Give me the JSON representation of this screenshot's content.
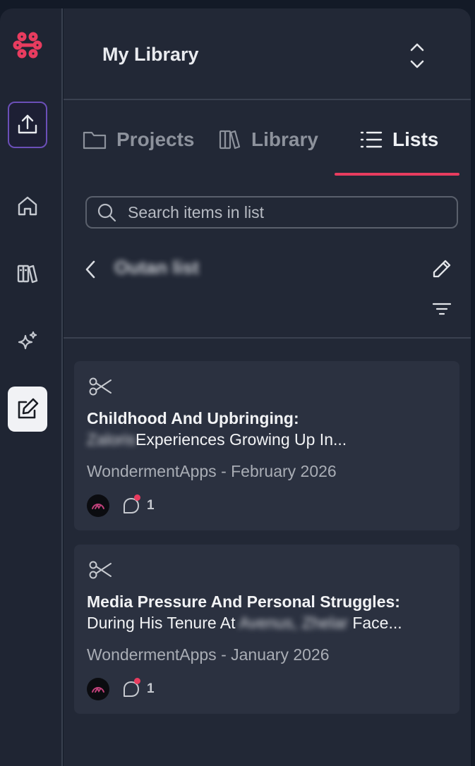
{
  "rail": {
    "logo_icon": "brand-logo-icon",
    "accent_color": "#e83c5f",
    "items": [
      "upload-icon",
      "home-icon",
      "library-books-icon",
      "sparkle-ai-icon",
      "edit-note-icon"
    ]
  },
  "header": {
    "title": "My Library"
  },
  "tabs": [
    {
      "label": "Projects",
      "icon": "folder-icon",
      "active": false
    },
    {
      "label": "Library",
      "icon": "books-icon",
      "active": false
    },
    {
      "label": "Lists",
      "icon": "list-icon",
      "active": true
    }
  ],
  "search": {
    "placeholder": "Search items in list"
  },
  "list": {
    "name": "Outan list"
  },
  "cards": [
    {
      "title_bold": "Childhood And Upbringing:",
      "title_redacted": "Zaloris",
      "title_rest": "Experiences Growing Up In...",
      "meta": "WondermentApps - February 2026",
      "comment_count": "1"
    },
    {
      "title_bold": "Media Pressure And Personal Struggles:",
      "title_prefix": "During His Tenure At",
      "title_redacted": "Avenus, Zhelar",
      "title_rest": "Face...",
      "meta": "WondermentApps - January 2026",
      "comment_count": "1"
    }
  ]
}
